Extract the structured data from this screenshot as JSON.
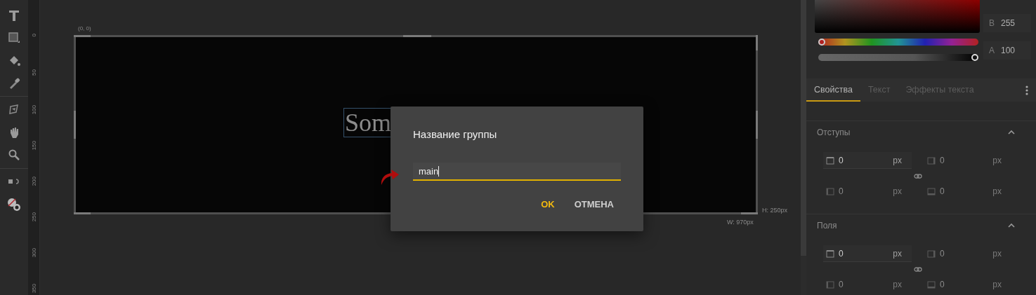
{
  "ruler": {
    "labels": [
      "0",
      "50",
      "100",
      "150",
      "200",
      "250",
      "300",
      "350"
    ]
  },
  "canvas": {
    "origin_label": "(0, 0)",
    "text_layer": "Som",
    "height_label": "H: 250px",
    "width_label": "W: 970px"
  },
  "color_picker": {
    "hue": {
      "level": 0
    },
    "alpha": {
      "level": 1
    },
    "channels": [
      {
        "label": "B",
        "value": "255"
      },
      {
        "label": "A",
        "value": "100"
      }
    ]
  },
  "tabs": [
    {
      "label": "Свойства",
      "selected": true
    },
    {
      "label": "Текст",
      "selected": false
    },
    {
      "label": "Эффекты текста",
      "selected": false
    }
  ],
  "sections": [
    {
      "title": "Отступы",
      "expanded": true,
      "fields": [
        {
          "value": "0",
          "unit": "px",
          "disabled": false
        },
        {
          "value": "0",
          "unit": "px",
          "disabled": true
        },
        {
          "value": "0",
          "unit": "px",
          "disabled": true
        },
        {
          "value": "0",
          "unit": "px",
          "disabled": true
        }
      ]
    },
    {
      "title": "Поля",
      "expanded": true,
      "fields": [
        {
          "value": "0",
          "unit": "px",
          "disabled": false
        },
        {
          "value": "0",
          "unit": "px",
          "disabled": true
        },
        {
          "value": "0",
          "unit": "px",
          "disabled": true
        },
        {
          "value": "0",
          "unit": "px",
          "disabled": true
        }
      ]
    }
  ],
  "dialog": {
    "title": "Название группы",
    "input": {
      "value": "main"
    },
    "buttons": [
      {
        "label": "OK",
        "kind": "primary"
      },
      {
        "label": "ОТМЕНА",
        "kind": "secondary"
      }
    ]
  }
}
